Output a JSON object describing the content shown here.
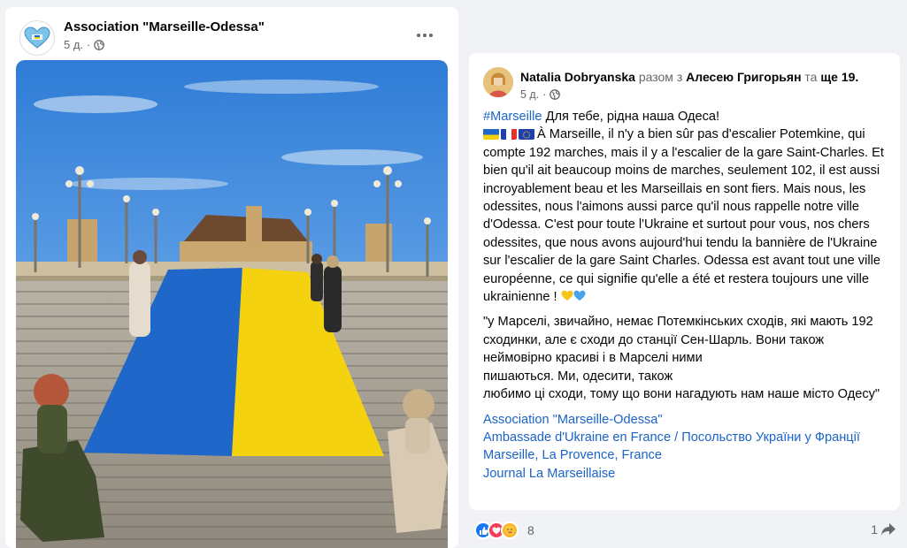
{
  "left_post": {
    "page_name": "Association \"Marseille-Odessa\"",
    "time": "5 д.",
    "privacy_icon": "globe-icon",
    "more_icon": "more-horizontal-icon",
    "photo_alt": "Women holding Ukrainian flag on stairs of Saint-Charles station"
  },
  "right_post": {
    "author": "Natalia Dobryanska",
    "with_word": "разом з",
    "tagged": "Алесею Григорьян",
    "and_word": "та",
    "others": "ще 19",
    "time": "5 д.",
    "hashtag": "#Marseille",
    "line1_rest": " Для тебе, рідна наша Одеса!",
    "french_text": "À Marseille, il n'y a bien sûr pas d'escalier Potemkine, qui compte 192 marches, mais il y a l'escalier de la gare Saint-Charles. Et bien qu'il ait beaucoup moins de marches, seulement 102, il est aussi incroyablement beau et les Marseillais en sont fiers. Mais nous, les odessites, nous l'aimons aussi parce qu'il nous rappelle notre ville d'Odessa. C'est pour toute l'Ukraine et surtout pour vous, nos chers odessites, que nous avons aujourd'hui tendu la bannière de l'Ukraine sur l'escalier de la gare Saint Charles. Odessa est avant tout une ville européenne, ce qui signifie qu'elle a été et restera toujours une ville ukrainienne !",
    "uk_line1": "\"у Марселі, звичайно, немає Потемкінських сходів, які мають 192 сходинки, але є сходи до станції Сен-Шарль. Вони також неймовірно красиві і в Марселі ними",
    "uk_line2": "пишаються. Ми, одесити, також",
    "uk_line3": "любимо ці сходи, тому що вони нагадують нам наше місто Одесу\"",
    "links": [
      "Association \"Marseille-Odessa\"",
      "Ambassade d'Ukraine en France / Посольство України у Франції",
      "Marseille, La Provence, France",
      "Journal La Marseillaise"
    ],
    "reaction_count": "8",
    "share_count": "1"
  },
  "colors": {
    "link": "#1a64c8",
    "secondary_text": "#65676b",
    "flag_blue": "#1f68c9",
    "flag_yellow": "#f5d20f"
  }
}
